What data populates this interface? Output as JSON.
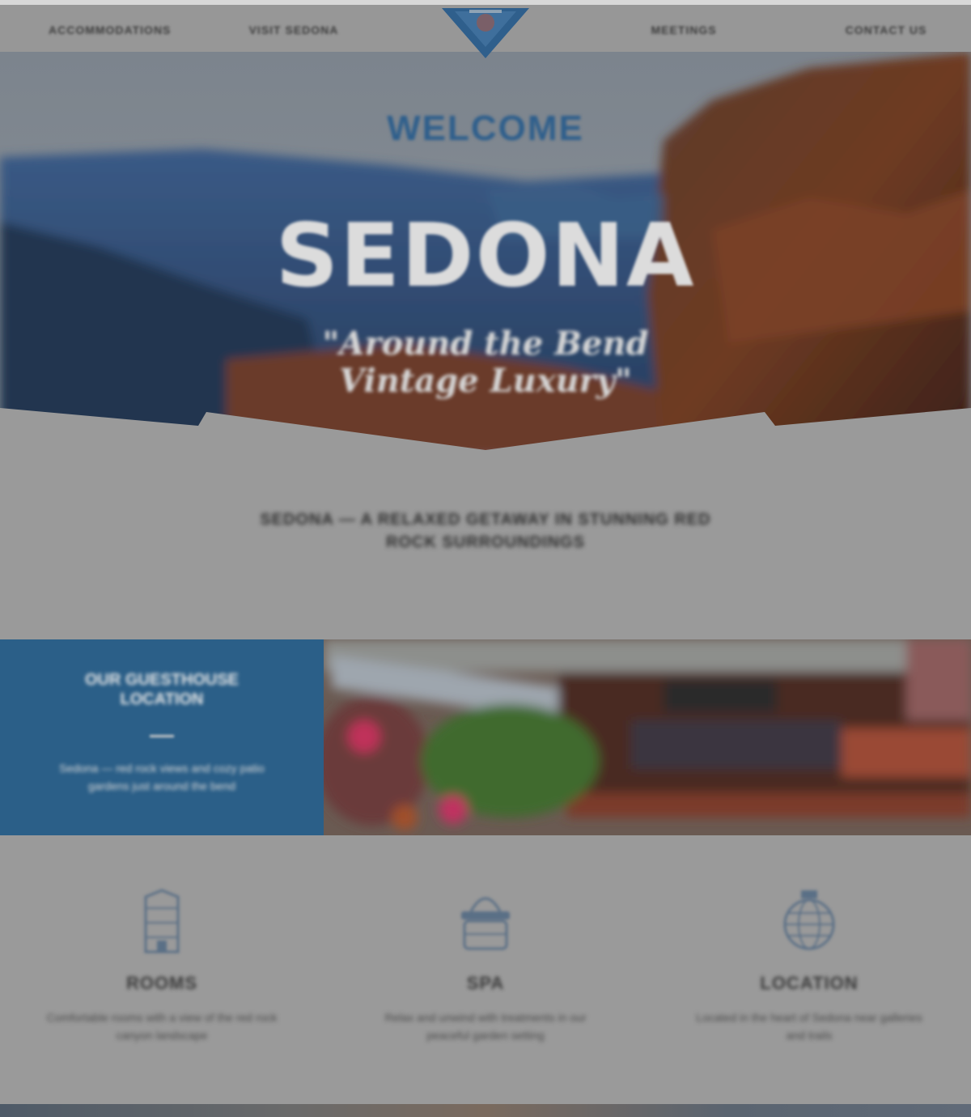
{
  "nav": {
    "links": [
      {
        "label": "Accommodations"
      },
      {
        "label": "Visit Sedona"
      },
      {
        "label": "Meetings"
      },
      {
        "label": "Contact Us"
      }
    ],
    "logo_icon": "shield-logo-icon"
  },
  "hero": {
    "welcome": "WELCOME",
    "welcome_sub": "",
    "title": "SEDONA",
    "tagline_line1": "\"Around the Bend",
    "tagline_line2": "Vintage Luxury\""
  },
  "intro": {
    "heading": "Sedona — a relaxed getaway in stunning red rock surroundings",
    "text": ""
  },
  "feature": {
    "title": "Our Guesthouse Location",
    "description": "Sedona — red rock views and cozy patio gardens just around the bend"
  },
  "services": [
    {
      "title": "Rooms",
      "icon": "building-icon",
      "text": "Comfortable rooms with a view of the red rock canyon landscape"
    },
    {
      "title": "Spa",
      "icon": "spa-basket-icon",
      "text": "Relax and unwind with treatments in our peaceful garden setting"
    },
    {
      "title": "Location",
      "icon": "globe-icon",
      "text": "Located in the heart of Sedona near galleries and trails"
    }
  ],
  "colors": {
    "accent_blue": "#2b5f88",
    "page_bg": "#9a9a9a",
    "nav_bg": "#979797"
  }
}
